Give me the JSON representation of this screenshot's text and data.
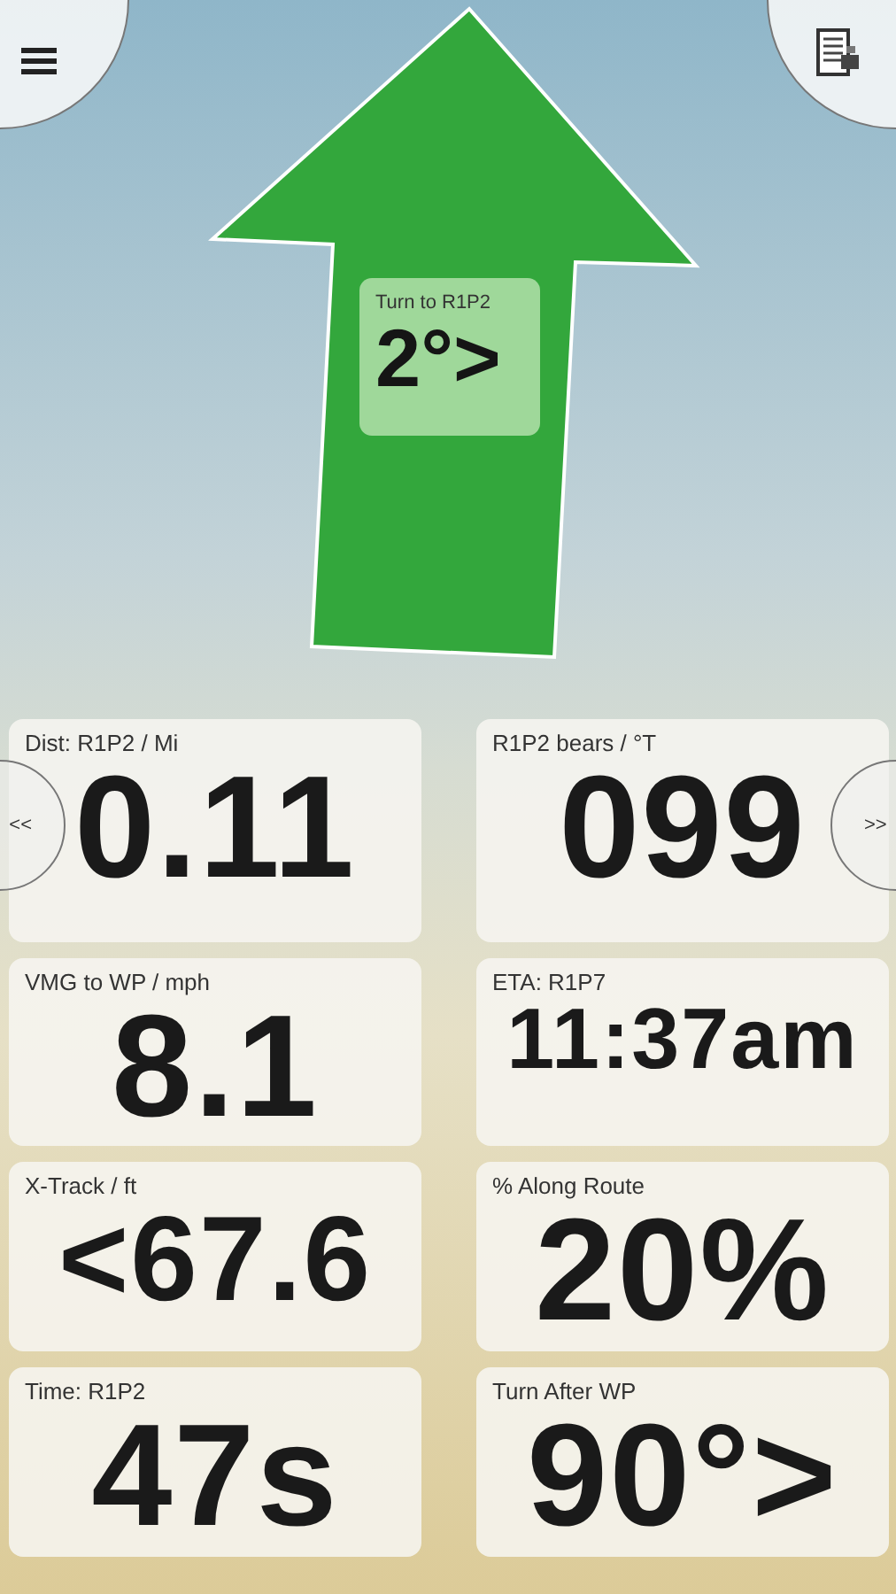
{
  "turn_indicator": {
    "label": "Turn to R1P2",
    "value": "2°>"
  },
  "nav": {
    "prev": "<<",
    "next": ">>"
  },
  "cards": [
    {
      "label": "Dist: R1P2 / Mi",
      "value": "0.11"
    },
    {
      "label": "R1P2 bears / °T",
      "value": "099"
    },
    {
      "label": "VMG to WP / mph",
      "value": "8.1"
    },
    {
      "label": "ETA: R1P7",
      "value": "11:37am"
    },
    {
      "label": "X-Track / ft",
      "value": "<67.6"
    },
    {
      "label": "% Along Route",
      "value": "20%"
    },
    {
      "label": "Time: R1P2",
      "value": "47s"
    },
    {
      "label": "Turn After WP",
      "value": "90°>"
    }
  ]
}
